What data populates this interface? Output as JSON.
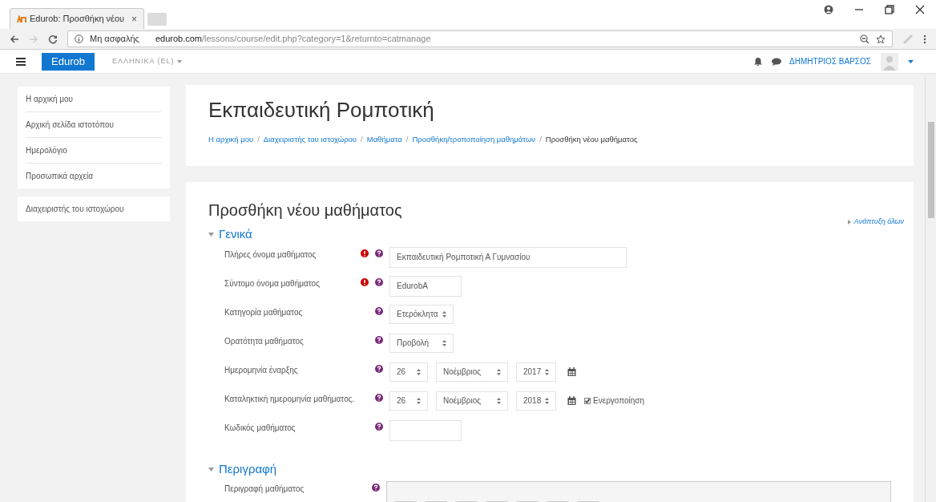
{
  "browser": {
    "tab_title": "Edurob: Προσθήκη νέου",
    "tab_close": "×",
    "security": "Μη ασφαλής",
    "url_host": "edurob.com",
    "url_path": "/lessons/course/edit.php?category=1&returnto=catmanage"
  },
  "navbar": {
    "brand": "Edurob",
    "language": "ΕΛΛΗΝΙΚΑ (EL)",
    "user": "ΔΗΜΗΤΡΙΟΣ ΒΑΡΣΟΣ"
  },
  "sidebar": {
    "groups": [
      [
        "Η αρχική μου",
        "Αρχική σελίδα ιστοτόπου",
        "Ημερολόγιο",
        "Προσωπικά αρχεία"
      ],
      [
        "Διαχειριστής του ιστοχώρου"
      ]
    ]
  },
  "header": {
    "title": "Εκπαιδευτική Ρομποτική",
    "breadcrumbs": [
      "Η αρχική μου",
      "Διαχειριστής του ιστοχώρου",
      "Μαθήματα",
      "Προσθήκη/τροποποίηση μαθημάτων",
      "Προσθήκη νέου μαθήματος"
    ],
    "separator": "/"
  },
  "form": {
    "title": "Προσθήκη νέου μαθήματος",
    "expand_all": "Ανάπτυξη όλων",
    "sections": [
      {
        "title": "Γενικά",
        "expanded": true,
        "fields": [
          {
            "kind": "text",
            "label": "Πλήρες όνομα μαθήματος",
            "required": true,
            "value": "Εκπαιδευτική Ρομποτική Α Γυμνασίου",
            "wide": true
          },
          {
            "kind": "text",
            "label": "Σύντομο όνομα μαθήματος",
            "required": true,
            "value": "EdurobA",
            "wide": false
          },
          {
            "kind": "select",
            "label": "Κατηγορία μαθήματος",
            "required": false,
            "value": "Ετερόκλητα"
          },
          {
            "kind": "select",
            "label": "Ορατότητα μαθήματος",
            "required": false,
            "value": "Προβολή"
          },
          {
            "kind": "date",
            "label": "Ημερομηνία έναρξης",
            "required": false,
            "day": "26",
            "month": "Νοέμβριος",
            "year": "2017"
          },
          {
            "kind": "date",
            "label": "Καταληκτική ημερομηνία μαθήματος.",
            "required": false,
            "day": "26",
            "month": "Νοέμβριος",
            "year": "2018",
            "enable": {
              "label": "Ενεργοποίηση",
              "checked": true
            }
          },
          {
            "kind": "text",
            "label": "Κωδικός μαθήματος",
            "required": false,
            "wide": false
          }
        ]
      },
      {
        "title": "Περιγραφή",
        "expanded": true,
        "fields": [
          {
            "kind": "editor",
            "label": "Περιγραφή μαθήματος",
            "required": false
          }
        ]
      }
    ]
  }
}
